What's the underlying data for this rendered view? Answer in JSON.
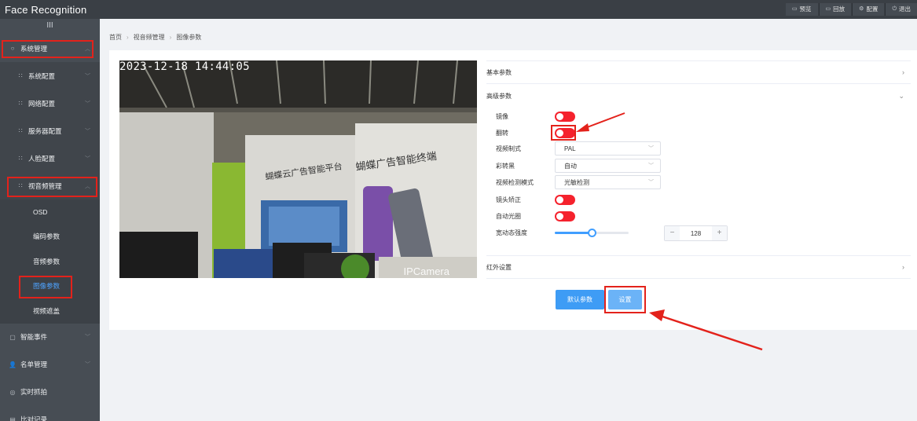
{
  "app": {
    "title": "Face Recognition"
  },
  "topnav": [
    {
      "label": "预览",
      "icon": "preview-icon"
    },
    {
      "label": "回放",
      "icon": "playback-icon"
    },
    {
      "label": "配置",
      "icon": "gear-icon"
    },
    {
      "label": "退出",
      "icon": "power-icon"
    }
  ],
  "sidebar": {
    "collapse_glyph": "III",
    "items": [
      {
        "label": "系统管理"
      },
      {
        "label": "系统配置"
      },
      {
        "label": "网络配置"
      },
      {
        "label": "服务器配置"
      },
      {
        "label": "人脸配置"
      },
      {
        "label": "视音频管理"
      },
      {
        "label": "OSD"
      },
      {
        "label": "编码参数"
      },
      {
        "label": "音频参数"
      },
      {
        "label": "图像参数"
      },
      {
        "label": "视频遮盖"
      },
      {
        "label": "智能事件"
      },
      {
        "label": "名单管理"
      },
      {
        "label": "实时抓拍"
      },
      {
        "label": "比对记录"
      }
    ]
  },
  "breadcrumb": [
    "首页",
    "视音频管理",
    "图像参数"
  ],
  "camera": {
    "timestamp": "2023-12-18 14:44:05",
    "overlay_name": "IPCamera",
    "wall_text_left": "蝴蝶云广告智能平台",
    "wall_text_right": "蝴蝶广告智能终端"
  },
  "sections": {
    "basic": "基本参数",
    "advanced": "高级参数",
    "infrared": "红外设置"
  },
  "advanced": {
    "mirror_label": "镜像",
    "mirror_on": false,
    "flip_label": "翻转",
    "flip_on": false,
    "video_standard_label": "视频制式",
    "video_standard_value": "PAL",
    "color_to_bw_label": "彩转黑",
    "color_to_bw_value": "自动",
    "detect_mode_label": "视频检测模式",
    "detect_mode_value": "光敏检测",
    "lens_correction_label": "镜头矫正",
    "lens_correction_on": false,
    "auto_iris_label": "自动光圈",
    "auto_iris_on": false,
    "wdr_label": "宽动态强度",
    "wdr_value": "128",
    "wdr_fraction": 0.5,
    "minus": "−",
    "plus": "+"
  },
  "buttons": {
    "default_params": "默认参数",
    "set": "设置"
  },
  "colors": {
    "topbar": "#3a3f45",
    "sidebar": "#474d54",
    "switch_red": "#f5222d",
    "primary": "#409eff",
    "annotation_red": "#e3221b"
  }
}
